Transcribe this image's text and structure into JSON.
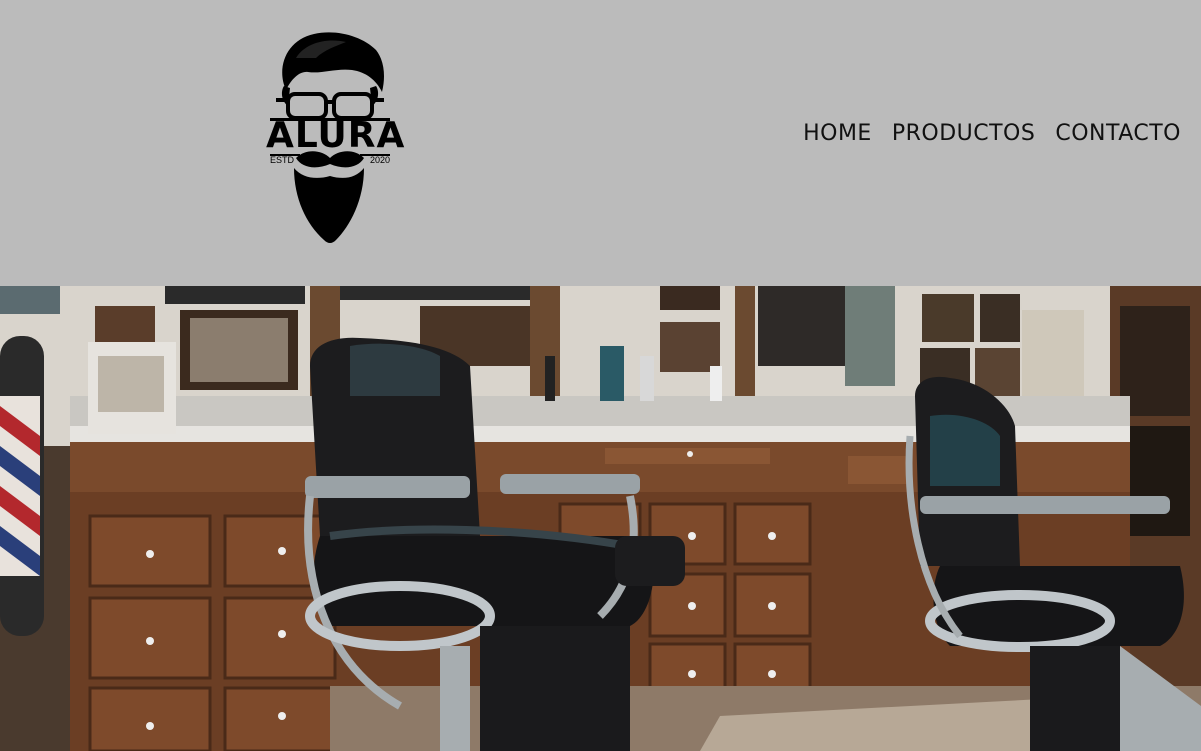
{
  "logo": {
    "name": "ALURA",
    "est": "ESTD",
    "year": "2020"
  },
  "nav": {
    "items": [
      {
        "label": "HOME"
      },
      {
        "label": "PRODUCTOS"
      },
      {
        "label": "CONTACTO"
      }
    ]
  },
  "hero": {
    "image": "barbershop-interior"
  },
  "colors": {
    "header_bg": "#bbbbbb",
    "nav_text": "#111111"
  }
}
